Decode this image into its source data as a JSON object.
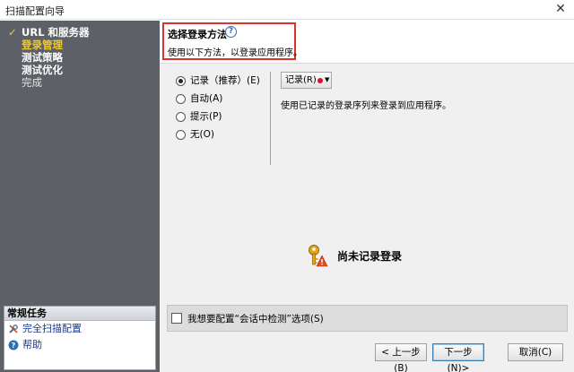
{
  "window": {
    "title": "扫描配置向导",
    "close_glyph": "✕"
  },
  "sidebar": {
    "steps": [
      {
        "label": "URL 和服务器",
        "state": "done"
      },
      {
        "label": "登录管理",
        "state": "active"
      },
      {
        "label": "测试策略",
        "state": "pending"
      },
      {
        "label": "测试优化",
        "state": "pending"
      },
      {
        "label": "完成",
        "state": "dim"
      }
    ],
    "check_glyph": "✓",
    "tasks_header": "常规任务",
    "tasks": [
      {
        "label": "完全扫描配置",
        "icon": "wrench-icon"
      },
      {
        "label": "帮助",
        "icon": "help-icon"
      }
    ]
  },
  "header": {
    "title": "选择登录方法",
    "help_glyph": "?",
    "subtitle": "使用以下方法，以登录应用程序。"
  },
  "login_options": [
    {
      "label": "记录（推荐）(E)",
      "selected": true
    },
    {
      "label": "自动(A)",
      "selected": false
    },
    {
      "label": "提示(P)",
      "selected": false
    },
    {
      "label": "无(O)",
      "selected": false
    }
  ],
  "record": {
    "button_label": "记录(R)",
    "caret": "▼",
    "description": "使用已记录的登录序列来登录到应用程序。"
  },
  "status": {
    "text": "尚未记录登录"
  },
  "session_check": {
    "label": "我想要配置“会话中检测”选项(S)",
    "checked": false
  },
  "buttons": {
    "back": "< 上一步(B)",
    "next": "下一步(N)>",
    "cancel": "取消(C)"
  },
  "colors": {
    "sidebar_bg": "#5d6167",
    "active_step": "#f3c623",
    "highlight_border": "#e0302a",
    "record_dot": "#d8102a"
  }
}
